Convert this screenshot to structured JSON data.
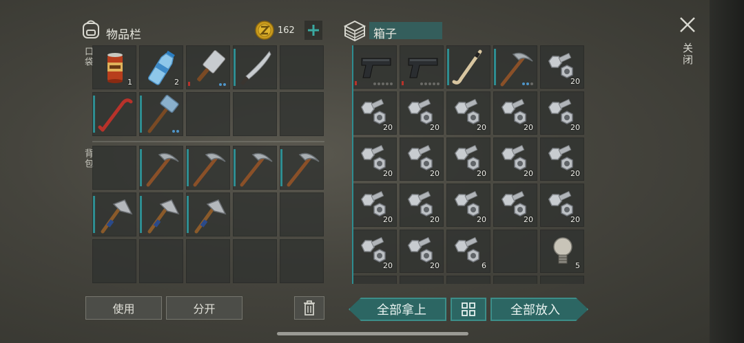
{
  "inventory": {
    "title": "物品栏",
    "coins": "162",
    "pocket_label": "口袋",
    "backpack_label": "背包",
    "pocket_items": [
      {
        "icon": "canned-food-icon",
        "count": "1"
      },
      {
        "icon": "water-bottle-icon",
        "count": "2"
      },
      {
        "icon": "cleaver-icon",
        "count": ""
      },
      {
        "icon": "machete-icon",
        "count": ""
      },
      {
        "icon": "",
        "count": ""
      },
      {
        "icon": "crowbar-icon",
        "count": ""
      },
      {
        "icon": "sledgehammer-icon",
        "count": ""
      },
      {
        "icon": "",
        "count": ""
      },
      {
        "icon": "",
        "count": ""
      },
      {
        "icon": "",
        "count": ""
      }
    ],
    "backpack_items": [
      {
        "icon": "",
        "count": ""
      },
      {
        "icon": "pickaxe-icon",
        "count": ""
      },
      {
        "icon": "pickaxe-icon",
        "count": ""
      },
      {
        "icon": "pickaxe-icon",
        "count": ""
      },
      {
        "icon": "pickaxe-icon",
        "count": ""
      },
      {
        "icon": "hatchet-icon",
        "count": ""
      },
      {
        "icon": "hatchet-icon",
        "count": ""
      },
      {
        "icon": "hatchet-icon",
        "count": ""
      },
      {
        "icon": "",
        "count": ""
      },
      {
        "icon": "",
        "count": ""
      },
      {
        "icon": "",
        "count": ""
      },
      {
        "icon": "",
        "count": ""
      },
      {
        "icon": "",
        "count": ""
      },
      {
        "icon": "",
        "count": ""
      },
      {
        "icon": "",
        "count": ""
      }
    ],
    "use_button": "使用",
    "split_button": "分开"
  },
  "box": {
    "title": "箱子",
    "items": [
      {
        "icon": "pistol-icon",
        "count": ""
      },
      {
        "icon": "pistol-icon",
        "count": ""
      },
      {
        "icon": "hockey-stick-icon",
        "count": ""
      },
      {
        "icon": "pickaxe-icon",
        "count": ""
      },
      {
        "icon": "bolt-nut-icon",
        "count": "20"
      },
      {
        "icon": "bolt-nut-icon",
        "count": "20"
      },
      {
        "icon": "bolt-nut-icon",
        "count": "20"
      },
      {
        "icon": "bolt-nut-icon",
        "count": "20"
      },
      {
        "icon": "bolt-nut-icon",
        "count": "20"
      },
      {
        "icon": "bolt-nut-icon",
        "count": "20"
      },
      {
        "icon": "bolt-nut-icon",
        "count": "20"
      },
      {
        "icon": "bolt-nut-icon",
        "count": "20"
      },
      {
        "icon": "bolt-nut-icon",
        "count": "20"
      },
      {
        "icon": "bolt-nut-icon",
        "count": "20"
      },
      {
        "icon": "bolt-nut-icon",
        "count": "20"
      },
      {
        "icon": "bolt-nut-icon",
        "count": "20"
      },
      {
        "icon": "bolt-nut-icon",
        "count": "20"
      },
      {
        "icon": "bolt-nut-icon",
        "count": "20"
      },
      {
        "icon": "bolt-nut-icon",
        "count": "20"
      },
      {
        "icon": "bolt-nut-icon",
        "count": "20"
      },
      {
        "icon": "bolt-nut-icon",
        "count": "20"
      },
      {
        "icon": "bolt-nut-icon",
        "count": "20"
      },
      {
        "icon": "bolt-nut-icon",
        "count": "6"
      },
      {
        "icon": "",
        "count": ""
      },
      {
        "icon": "light-bulb-icon",
        "count": "5"
      }
    ],
    "take_all_button": "全部拿上",
    "put_all_button": "全部放入"
  },
  "close_label": "关闭",
  "colors": {
    "accent": "#2e8e92",
    "teal_button": "#2c6663"
  }
}
